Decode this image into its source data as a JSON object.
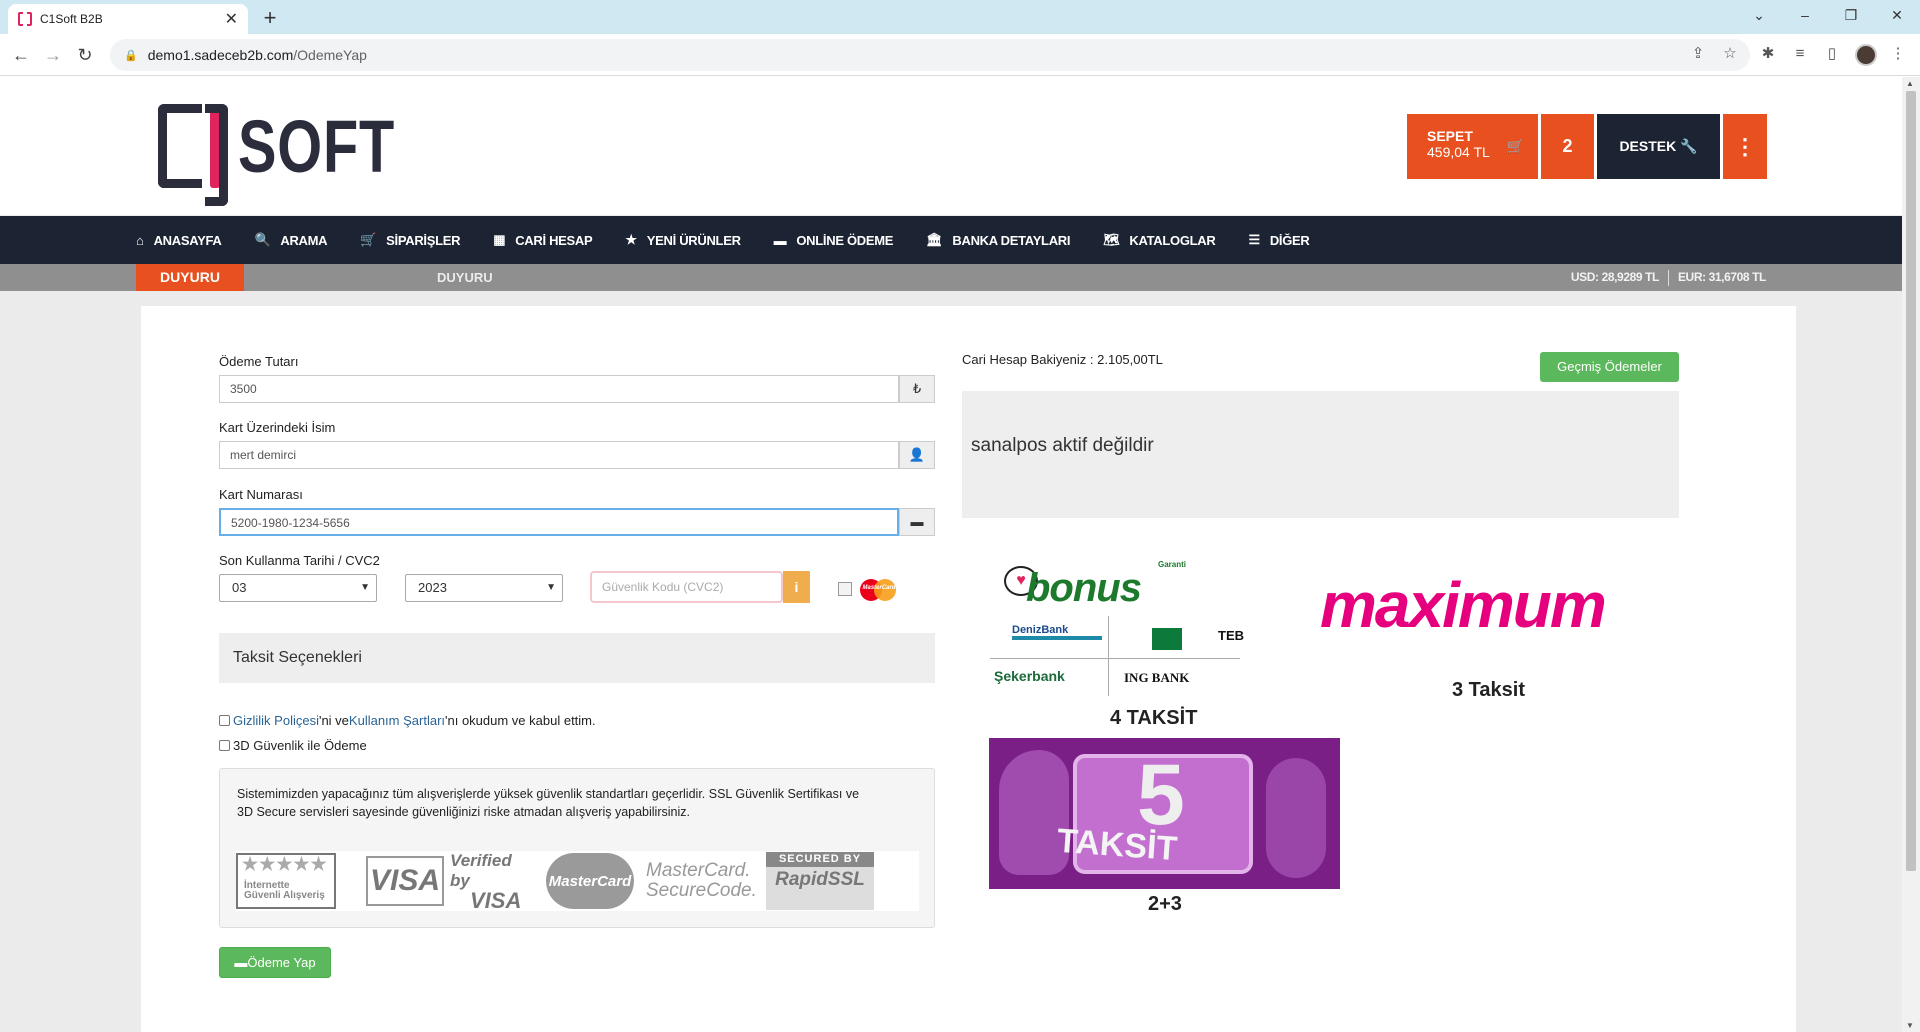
{
  "browser": {
    "tab_title": "C1Soft B2B",
    "url_host": "demo1.sadeceb2b.com",
    "url_path": "/OdemeYap"
  },
  "header": {
    "logo_text": "SOFT",
    "cart_label": "SEPET",
    "cart_total": "459,04 TL",
    "cart_count": "2",
    "support_label": "DESTEK"
  },
  "nav": {
    "items": [
      {
        "label": "ANASAYFA",
        "icon": "home-icon"
      },
      {
        "label": "ARAMA",
        "icon": "search-icon"
      },
      {
        "label": "SİPARİŞLER",
        "icon": "cart-icon"
      },
      {
        "label": "CARİ HESAP",
        "icon": "calculator-icon"
      },
      {
        "label": "YENİ ÜRÜNLER",
        "icon": "star-icon"
      },
      {
        "label": "ONLİNE ÖDEME",
        "icon": "credit-card-icon"
      },
      {
        "label": "BANKA DETAYLARI",
        "icon": "bank-icon"
      },
      {
        "label": "KATALOGLAR",
        "icon": "map-icon"
      },
      {
        "label": "DİĞER",
        "icon": "list-icon"
      }
    ]
  },
  "announcement": {
    "label": "DUYURU",
    "text": "DUYURU",
    "usd": "USD: 28,9289 TL",
    "eur": "EUR: 31,6708 TL"
  },
  "form": {
    "amount_label": "Ödeme Tutarı",
    "amount_value": "3500",
    "amount_addon": "₺",
    "name_label": "Kart Üzerindeki İsim",
    "name_value": "mert demirci",
    "card_label": "Kart Numarası",
    "card_value": "5200-1980-1234-5656",
    "expiry_label": "Son Kullanma Tarihi / CVC2",
    "month_value": "03",
    "year_value": "2023",
    "cvc_placeholder": "Güvenlik Kodu (CVC2)",
    "info_label": "i",
    "installments_label": "Taksit Seçenekleri",
    "privacy_link": "Gizlilik Poliçesi",
    "privacy_mid": "'ni ve ",
    "terms_link": "Kullanım Şartları",
    "terms_tail": "'nı okudum ve kabul ettim.",
    "secure_label": "3D Güvenlik ile Ödeme",
    "security_text": "Sistemimizden yapacağınız tüm alışverişlerde yüksek güvenlik standartları geçerlidir. SSL Güvenlik Sertifikası ve 3D Secure servisleri sayesinde güvenliğinizi riske atmadan alışveriş yapabilirsiniz.",
    "pay_button": "Ödeme Yap",
    "mastercard_small": "MasterCard"
  },
  "badges": {
    "internet_1": "İnternette",
    "internet_2": "Güvenli Alışveriş",
    "visa": "VISA",
    "verified_1": "Verified by",
    "verified_2": "VISA",
    "mastercard": "MasterCard",
    "securecode_1": "MasterCard.",
    "securecode_2": "SecureCode.",
    "rapidssl_1": "SECURED BY",
    "rapidssl_2": "RapidSSL"
  },
  "right": {
    "balance_label": "Cari Hesap Bakiyeniz : ",
    "balance_value": "2.105,00TL",
    "history_button": "Geçmiş Ödemeler",
    "sanalpos_text": "sanalpos aktif değildir",
    "bonus_word": "bonus",
    "garanti": "Garanti",
    "denizbank": "DenizBank",
    "teb": "TEB",
    "sekerbank": "Şekerbank",
    "ingbank": "ING BANK",
    "bonus_caption": "4 TAKSİT",
    "maximum_word": "maximum",
    "maximum_caption": "3 Taksit",
    "promo_number": "5",
    "promo_word": "TAKSİT",
    "promo_caption": "2+3"
  }
}
